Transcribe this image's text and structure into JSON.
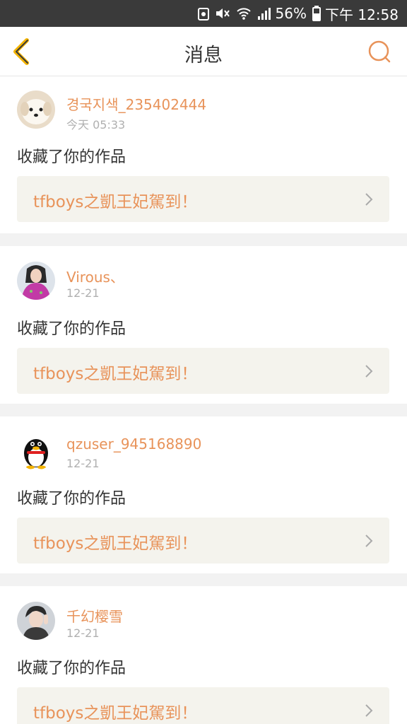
{
  "status_bar": {
    "battery": "56%",
    "time": "下午 12:58",
    "icons": [
      "notification-icon",
      "mute-icon",
      "wifi-icon",
      "signal-icon",
      "battery-icon"
    ]
  },
  "nav": {
    "title": "消息",
    "back_icon": "chevron-left-icon",
    "search_icon": "search-icon",
    "accent_color": "#e8935a"
  },
  "messages": [
    {
      "user": "경국지색_235402444",
      "time": "今天 05:33",
      "action": "收藏了你的作品",
      "work_title": "tfboys之凱王妃駕到！",
      "avatar": "puppy-avatar"
    },
    {
      "user": "Virous、",
      "time": "12-21",
      "action": "收藏了你的作品",
      "work_title": "tfboys之凱王妃駕到！",
      "avatar": "girl-avatar"
    },
    {
      "user": "qzuser_945168890",
      "time": "12-21",
      "action": "收藏了你的作品",
      "work_title": "tfboys之凱王妃駕到！",
      "avatar": "penguin-avatar"
    },
    {
      "user": "千幻樱雪",
      "time": "12-21",
      "action": "收藏了你的作品",
      "work_title": "tfboys之凱王妃駕到！",
      "avatar": "boy-avatar"
    }
  ]
}
